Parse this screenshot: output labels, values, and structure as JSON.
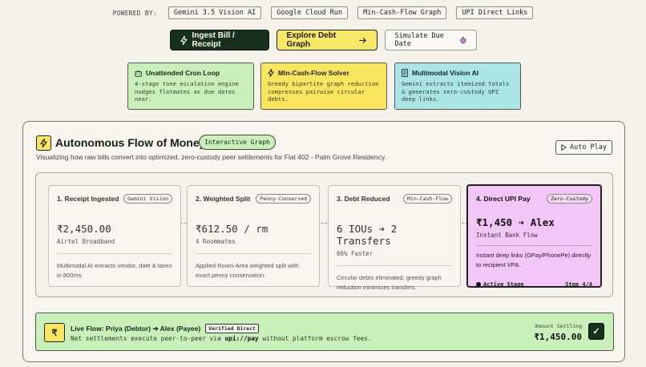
{
  "powered": {
    "label": "POWERED BY:",
    "chips": [
      "Gemini 3.5 Vision AI",
      "Google Cloud Run",
      "Min-Cash-Flow Graph",
      "UPI Direct Links"
    ]
  },
  "actions": {
    "ingest": "Ingest Bill / Receipt",
    "explore": "Explore Debt Graph",
    "simulate": "Simulate Due Date"
  },
  "features": [
    {
      "title": "Unattended Cron Loop",
      "desc": "4-stage tone escalation engine nudges flatmates as due dates near.",
      "icon": "robot-icon"
    },
    {
      "title": "Min-Cash-Flow Solver",
      "desc": "Greedy bipartite graph reduction compresses pairwise circular debts.",
      "icon": "bolt-icon"
    },
    {
      "title": "Multimodal Vision AI",
      "desc": "Gemini extracts itemized totals & generates zero-custody UPI deep links.",
      "icon": "receipt-icon"
    }
  ],
  "panel": {
    "title": "Autonomous Flow of Money",
    "badge": "Interactive Graph",
    "subtitle": "Visualizing how raw bills convert into optimized, zero-custody peer settlements for Flat 402 - Palm Grove Residency.",
    "autoplay": "Auto Play"
  },
  "stages": [
    {
      "title": "1. Receipt Ingested",
      "tag": "Gemini Vision",
      "value": "₹2,450.00",
      "sub": "Airtel Broadband",
      "desc": "Multimodal AI extracts vendor, date & taxes in 800ms."
    },
    {
      "title": "2. Weighted Split",
      "tag": "Penny-Conserved",
      "value": "₹612.50 / rm",
      "sub": "4 Roommates",
      "desc": "Applied Room-Area weighted split with exact penny conservation."
    },
    {
      "title": "3. Debt Reduced",
      "tag": "Min-Cash-Flow",
      "value": "6 IOUs ➔ 2 Transfers",
      "sub": "66% Faster",
      "desc": "Circular debts eliminated; greedy graph reduction minimizes transfers."
    },
    {
      "title": "4. Direct UPI Pay",
      "tag": "Zero-Custody",
      "value": "₹1,450 ➔ Alex",
      "sub": "Instant Bank Flow",
      "desc": "Instant deep links (GPay/PhonePe) directly to recipient VPA.",
      "active_label": "Active Stage",
      "step": "Step 4/4"
    }
  ],
  "live": {
    "icon_glyph": "₹",
    "title": "Live Flow: Priya (Debtor) ➔ Alex (Payee)",
    "verified": "Verified Direct",
    "sub_pre": "Net settlements execute peer-to-peer via ",
    "sub_code": "upi://pay",
    "sub_post": " without platform escrow fees.",
    "amount_label": "Amount Settling",
    "amount": "₹1,450.00",
    "check_glyph": "✓"
  },
  "colors": {
    "background": "#f4f2e9",
    "dark_green": "#17311e",
    "yellow": "#f9e55e",
    "mint": "#c9f0b9",
    "cyan": "#a9e5e3",
    "pink": "#f2c6f7"
  }
}
